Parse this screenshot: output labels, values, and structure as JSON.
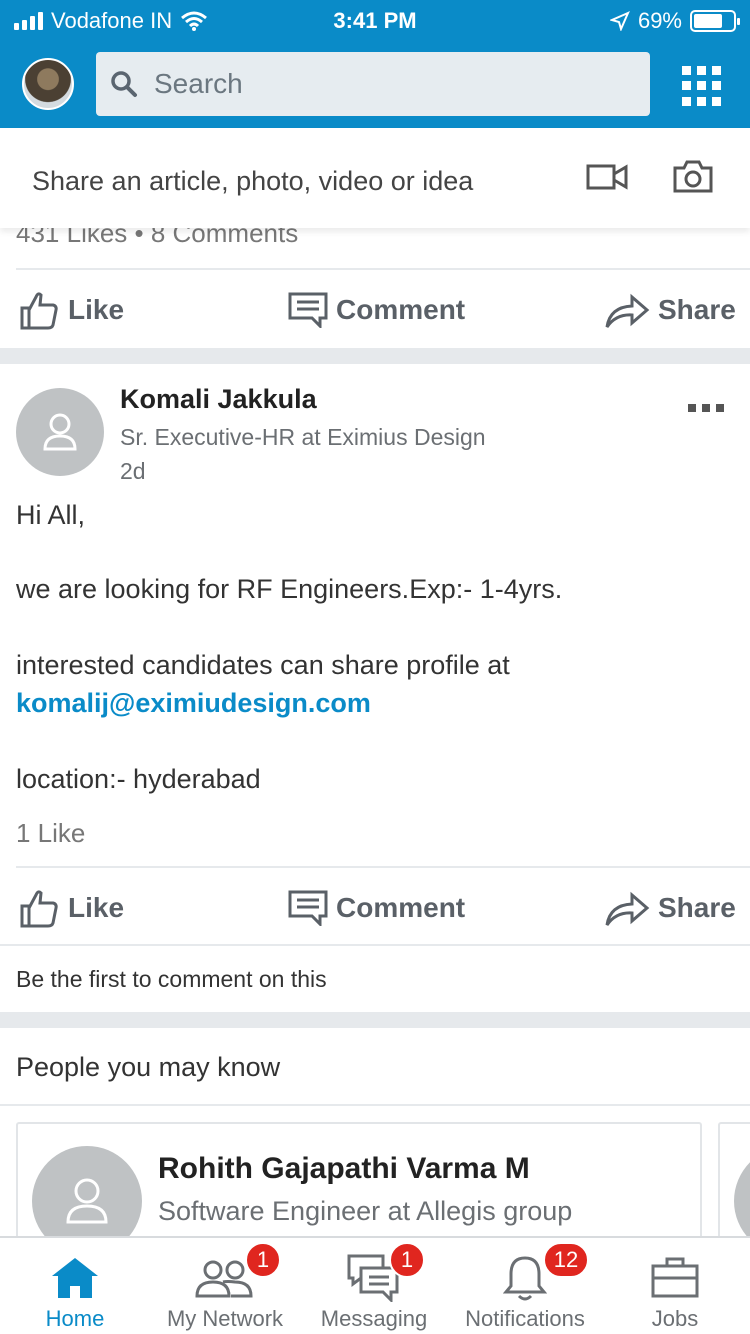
{
  "status_bar": {
    "carrier": "Vodafone IN",
    "time": "3:41 PM",
    "battery": "69%",
    "battery_level": 0.69
  },
  "header": {
    "search_placeholder": "Search"
  },
  "share_box": {
    "prompt": "Share an article, photo, video or idea"
  },
  "prev_post": {
    "stats": "431 Likes • 8 Comments"
  },
  "actions": {
    "like": "Like",
    "comment": "Comment",
    "share": "Share"
  },
  "post": {
    "author": "Komali Jakkula",
    "headline": "Sr. Executive-HR at Eximius Design",
    "time": "2d",
    "body": [
      "Hi All,",
      "we are looking for RF Engineers.Exp:- 1-4yrs.",
      "interested candidates can share profile at",
      "location:- hyderabad"
    ],
    "link": "komalij@eximiudesign.com",
    "likes": "1 Like",
    "comment_prompt": "Be the first to comment on this"
  },
  "pymk": {
    "title": "People you may know",
    "person": {
      "name": "Rohith Gajapathi Varma M",
      "headline": "Software Engineer at Allegis group"
    }
  },
  "bottom_nav": {
    "home": "Home",
    "network": "My Network",
    "network_badge": "1",
    "messaging": "Messaging",
    "messaging_badge": "1",
    "notifications": "Notifications",
    "notifications_badge": "12",
    "jobs": "Jobs"
  },
  "colors": {
    "brand": "#0a8bc8",
    "badge": "#e0261f"
  }
}
